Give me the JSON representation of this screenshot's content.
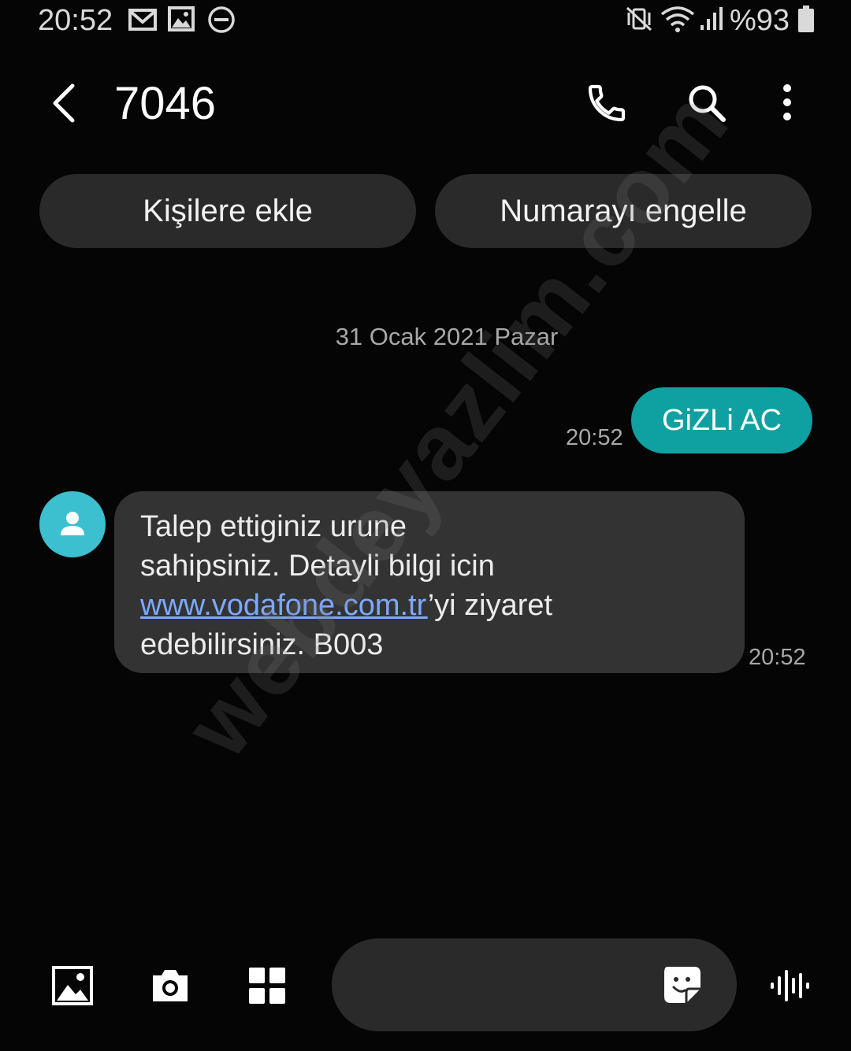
{
  "status_bar": {
    "time": "20:52",
    "battery_text": "%93",
    "left_icons": [
      "mail-icon",
      "image-icon",
      "do-not-disturb-icon"
    ],
    "right_icons": [
      "mute-vibrate-icon",
      "wifi-icon",
      "signal-icon",
      "battery-icon"
    ]
  },
  "header": {
    "title": "7046",
    "icons": [
      "back-arrow-icon",
      "phone-icon",
      "search-icon",
      "more-vert-icon"
    ]
  },
  "actions": {
    "add_contact": "Kişilere ekle",
    "block_number": "Numarayı engelle"
  },
  "conversation": {
    "date_separator": "31 Ocak 2021 Pazar",
    "sent_message": {
      "text": "GiZLi AC",
      "time": "20:52"
    },
    "received_message": {
      "line1": "Talep ettiginiz urune",
      "line2": "sahipsiniz. Detayli bilgi icin",
      "link": "www.vodafone.com.tr",
      "line3_rest": "’yi ziyaret",
      "line4": "edebilirsiniz. B003",
      "time": "20:52"
    }
  },
  "composer": {
    "placeholder": "",
    "icons": [
      "gallery-icon",
      "camera-icon",
      "apps-grid-icon",
      "sticker-icon",
      "voice-icon"
    ]
  },
  "watermark": "webdeyazlim.com",
  "colors": {
    "background": "#050505",
    "sent_bubble": "#0fa1a1",
    "received_bubble": "#333333",
    "avatar": "#3cbfcf",
    "link": "#7ea8ff"
  }
}
